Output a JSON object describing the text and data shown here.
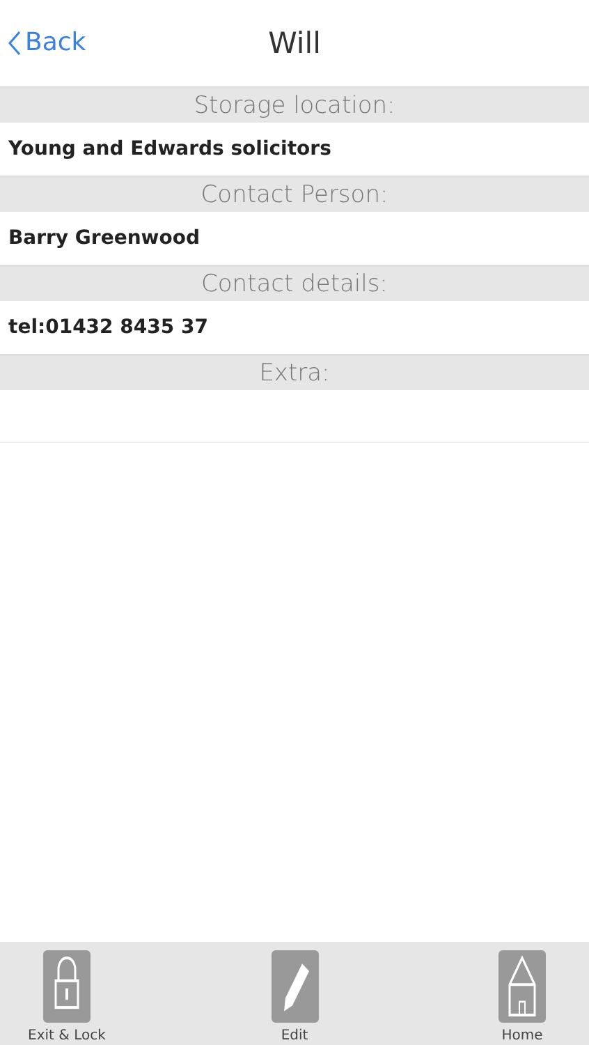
{
  "nav": {
    "back": "Back",
    "title": "Will"
  },
  "sections": [
    {
      "heading": "Storage location:",
      "value": "Young and Edwards solicitors"
    },
    {
      "heading": "Contact Person:",
      "value": "Barry Greenwood"
    },
    {
      "heading": "Contact details:",
      "value": "tel:01432 8435 37"
    },
    {
      "heading": "Extra:"
    }
  ],
  "tab_bar": [
    {
      "kind": "lock",
      "label": "Exit & Lock"
    },
    {
      "kind": "edit",
      "label": "Edit"
    },
    {
      "kind": "home",
      "label": "Home"
    }
  ]
}
